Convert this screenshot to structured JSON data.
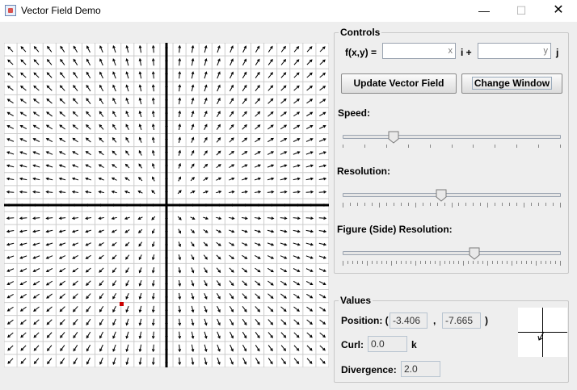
{
  "window": {
    "title": "Vector Field Demo",
    "minimize": "—",
    "maximize": "☐",
    "close": "✕"
  },
  "controls": {
    "title": "Controls",
    "fxy_label": "f(x,y) =",
    "i_field": {
      "value": "",
      "hint": "x"
    },
    "i_label": "i +",
    "j_field": {
      "value": "",
      "hint": "y"
    },
    "j_label": "j",
    "update_button": "Update Vector Field",
    "change_window_button": "Change Window",
    "speed": {
      "label": "Speed:",
      "value": 0.22
    },
    "resolution": {
      "label": "Resolution:",
      "value": 0.45
    },
    "side_resolution": {
      "label": "Figure (Side) Resolution:",
      "value": 0.61
    }
  },
  "values": {
    "title": "Values",
    "position_label": "Position: (",
    "x": "-3.406",
    "comma": ",",
    "y": "-7.665",
    "close_paren": ")",
    "curl_label": "Curl:",
    "curl": "0.0",
    "curl_unit": "k",
    "divergence_label": "Divergence:",
    "divergence": "2.0"
  },
  "field": {
    "expr_i": "x",
    "expr_j": "y",
    "marker_color": "#cc0000",
    "axis_color": "#000000",
    "grid_color": "#cccccc"
  }
}
